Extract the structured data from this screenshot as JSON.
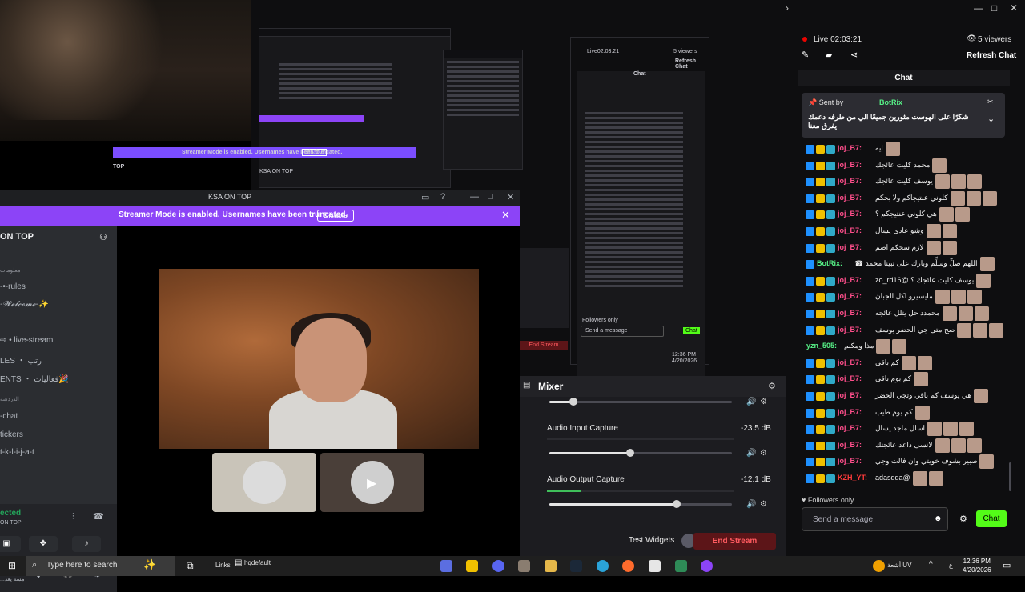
{
  "colors": {
    "accent_purple": "#8c44f7",
    "kick_green": "#53fc18",
    "live_red": "#eb0400",
    "end_stream_red": "#ff5a5f"
  },
  "discord": {
    "window_title": "KSA ON TOP",
    "streamer_mode_msg": "Streamer Mode is enabled. Usernames have been truncated.",
    "disable_label": "Disable",
    "server_name": "ON TOP",
    "channels": [
      {
        "label": "معلومات",
        "type": "category"
      },
      {
        "label": "-•-rules",
        "type": "channel"
      },
      {
        "label": "-𝓦𝓮𝓵𝓬𝓸𝓶𝓮-✨",
        "type": "channel"
      },
      {
        "label": "⇨ • live-stream",
        "type": "channel"
      },
      {
        "label": "LES ・ رتب",
        "type": "channel"
      },
      {
        "label": "ENTS ・ فعاليات🎉",
        "type": "channel"
      },
      {
        "label": "الدردشة",
        "type": "category"
      },
      {
        "label": "-chat",
        "type": "channel"
      },
      {
        "label": "tickers",
        "type": "channel"
      },
      {
        "label": "t-k-l-i-j-a-t",
        "type": "channel"
      }
    ],
    "voice_connected": "ected",
    "voice_sub": "ON TOP",
    "user_status": "...مسة يعد"
  },
  "mini_preview": {
    "title": "KSA ON TOP",
    "streamer_mode_msg": "Streamer Mode is enabled. Usernames have been truncated.",
    "disable_label": "Disable",
    "server_name": "TOP"
  },
  "mini_chat": {
    "live_text": "Live02:03:21",
    "viewers": "5 viewers",
    "refresh": "Refresh Chat",
    "title": "Chat",
    "followers": "Followers only",
    "placeholder": "Send a message",
    "chat_btn": "Chat",
    "end_stream": "End Stream",
    "taskbar_time": "12:36 PM",
    "taskbar_date": "4/20/2026"
  },
  "mixer": {
    "title": "Mixer",
    "tracks": [
      {
        "label": "",
        "db": "",
        "level": 0.12
      },
      {
        "label": "Audio Input Capture",
        "db": "-23.5 dB",
        "level": 0.44
      },
      {
        "label": "Audio Output Capture",
        "db": "-12.1 dB",
        "level": 0.7
      }
    ],
    "test_widgets": "Test Widgets",
    "end_stream": "End Stream"
  },
  "chat": {
    "live_text": "Live 02:03:21",
    "viewers": "5 viewers",
    "refresh": "Refresh Chat",
    "title": "Chat",
    "pinned_by": "Sent by",
    "pinned_bot": "BotRix",
    "pinned_text": "شكرًا على الهوست مثورين جميعًا الي من طرفه دعمك يفرق معنا",
    "messages": [
      {
        "user": "joj_B7:",
        "text": "ايه",
        "color": "#ff4f8b",
        "badges": 3
      },
      {
        "user": "joj_B7:",
        "text": "محمد كليت عائجك",
        "color": "#ff4f8b",
        "badges": 3
      },
      {
        "user": "joj_B7:",
        "text": "يوسف كليت عائجك",
        "color": "#ff4f8b",
        "badges": 3
      },
      {
        "user": "joj_B7:",
        "text": "كلوني عنتيجاكم ولا بحكم",
        "color": "#ff4f8b",
        "badges": 3
      },
      {
        "user": "joj_B7:",
        "text": "هي كلوني عنتيجكم ؟",
        "color": "#ff4f8b",
        "badges": 3
      },
      {
        "user": "joj_B7:",
        "text": "وشو عادي يسال",
        "color": "#ff4f8b",
        "badges": 3
      },
      {
        "user": "joj_B7:",
        "text": "لازم سحكم اصم",
        "color": "#ff4f8b",
        "badges": 3
      },
      {
        "user": "BotRix:",
        "text": "اللهم صلِّ وسلِّم وبارك على نبينا محمد ☎",
        "color": "#57f287",
        "badges": 1
      },
      {
        "user": "joj_B7:",
        "text": "يوسف كليت عائجك ؟ @zo_rd16",
        "color": "#ff4f8b",
        "badges": 3
      },
      {
        "user": "joj_B7:",
        "text": "مايسيرو اكل الجبان",
        "color": "#ff4f8b",
        "badges": 3
      },
      {
        "user": "joj_B7:",
        "text": "محمدد حل يتلل عائجه",
        "color": "#ff4f8b",
        "badges": 3
      },
      {
        "user": "joj_B7:",
        "text": "صح متى جي الحضر يوسف",
        "color": "#ff4f8b",
        "badges": 3
      },
      {
        "user": "yzn_505:",
        "text": "مذا ومكنم",
        "color": "#57f287",
        "badges": 0
      },
      {
        "user": "joj_B7:",
        "text": "كم باقي",
        "color": "#ff4f8b",
        "badges": 3
      },
      {
        "user": "joj_B7:",
        "text": "كم يوم باقي",
        "color": "#ff4f8b",
        "badges": 3
      },
      {
        "user": "joj_B7:",
        "text": "هي يوسف كم باقي وتجي الحضر",
        "color": "#ff4f8b",
        "badges": 3
      },
      {
        "user": "joj_B7:",
        "text": "كم يوم طيب",
        "color": "#ff4f8b",
        "badges": 3
      },
      {
        "user": "joj_B7:",
        "text": "اسال ماجد يسال",
        "color": "#ff4f8b",
        "badges": 3
      },
      {
        "user": "joj_B7:",
        "text": "لانسى داعد عائجتك",
        "color": "#ff4f8b",
        "badges": 3
      },
      {
        "user": "joj_B7:",
        "text": "صبير بشوف خويتي وان فالت وجي",
        "color": "#ff4f8b",
        "badges": 3
      },
      {
        "user": "KZH_YT:",
        "text": "@adasdqa",
        "color": "#ff3b3b",
        "badges": 3
      }
    ],
    "followers": "Followers only",
    "placeholder": "Send a message",
    "chat_btn": "Chat"
  },
  "taskbar": {
    "search_placeholder": "Type here to search",
    "links": "Links",
    "hq_label": "hqdefault",
    "weather": "أشعة UV",
    "lang": "ع",
    "time": "12:36 PM",
    "date": "4/20/2026"
  }
}
